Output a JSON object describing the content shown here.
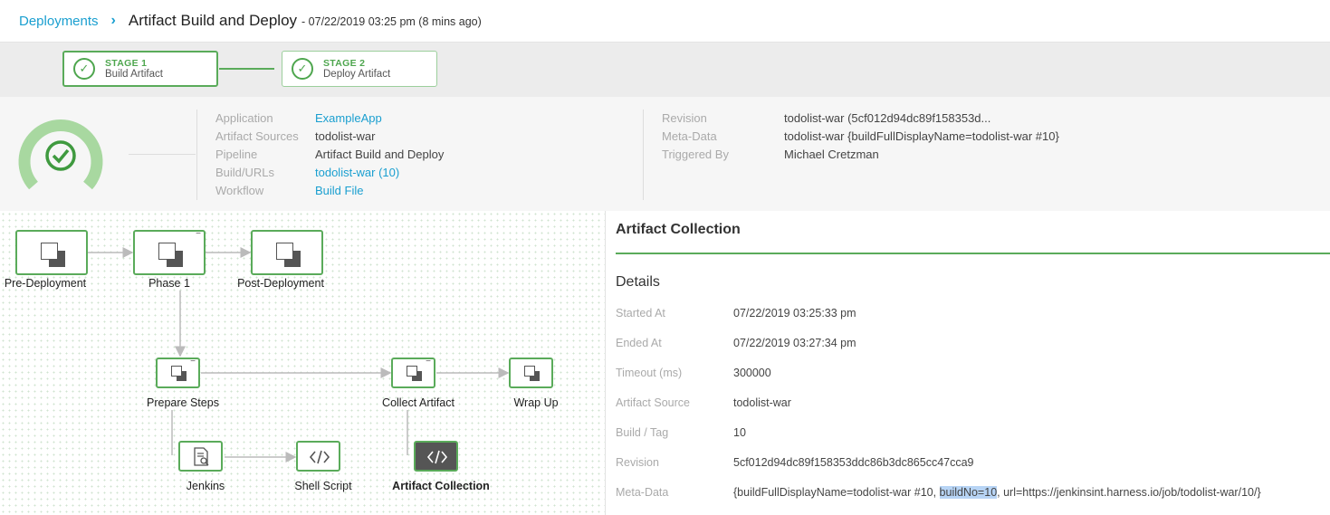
{
  "header": {
    "breadcrumb": "Deployments",
    "title": "Artifact Build and Deploy",
    "subtitle": "- 07/22/2019 03:25 pm (8 mins ago)"
  },
  "stages": [
    {
      "num": "STAGE 1",
      "name": "Build Artifact"
    },
    {
      "num": "STAGE 2",
      "name": "Deploy Artifact"
    }
  ],
  "summary": {
    "left": [
      {
        "key": "Application",
        "value": "ExampleApp",
        "link": true
      },
      {
        "key": "Artifact Sources",
        "value": "todolist-war",
        "link": false
      },
      {
        "key": "Pipeline",
        "value": "Artifact Build and Deploy",
        "link": false
      },
      {
        "key": "Build/URLs",
        "value": "todolist-war (10)",
        "link": true
      },
      {
        "key": "Workflow",
        "value": "Build File",
        "link": true
      }
    ],
    "right": [
      {
        "key": "Revision",
        "value": "todolist-war (5cf012d94dc89f158353d..."
      },
      {
        "key": "Meta-Data",
        "value": "todolist-war {buildFullDisplayName=todolist-war #10}"
      },
      {
        "key": "Triggered By",
        "value": "Michael Cretzman"
      }
    ]
  },
  "graph": {
    "pre_deployment": "Pre-Deployment",
    "phase1": "Phase 1",
    "post_deployment": "Post-Deployment",
    "prepare_steps": "Prepare Steps",
    "collect_artifact": "Collect Artifact",
    "wrap_up": "Wrap Up",
    "jenkins": "Jenkins",
    "shell_script": "Shell Script",
    "artifact_collection": "Artifact Collection",
    "collapse_symbol": "−"
  },
  "panel": {
    "title": "Artifact Collection",
    "details_heading": "Details",
    "rows": [
      {
        "key": "Started At",
        "value": "07/22/2019 03:25:33 pm"
      },
      {
        "key": "Ended At",
        "value": "07/22/2019 03:27:34 pm"
      },
      {
        "key": "Timeout (ms)",
        "value": "300000"
      },
      {
        "key": "Artifact Source",
        "value": "todolist-war"
      },
      {
        "key": "Build / Tag",
        "value": "10"
      },
      {
        "key": "Revision",
        "value": "5cf012d94dc89f158353ddc86b3dc865cc47cca9"
      }
    ],
    "metadata": {
      "key": "Meta-Data",
      "prefix": "{buildFullDisplayName=todolist-war #10, ",
      "highlight": "buildNo=10",
      "suffix": ", url=https://jenkinsint.harness.io/job/todolist-war/10/}"
    }
  },
  "colors": {
    "accent_green": "#5aab5a",
    "link_blue": "#1a9fd0",
    "gauge_green": "#a8d8a0"
  },
  "icons": {
    "stage_status": "check-circle-icon",
    "node": "copy-squares-icon",
    "jenkins": "document-search-icon",
    "shell": "code-brackets-icon"
  }
}
